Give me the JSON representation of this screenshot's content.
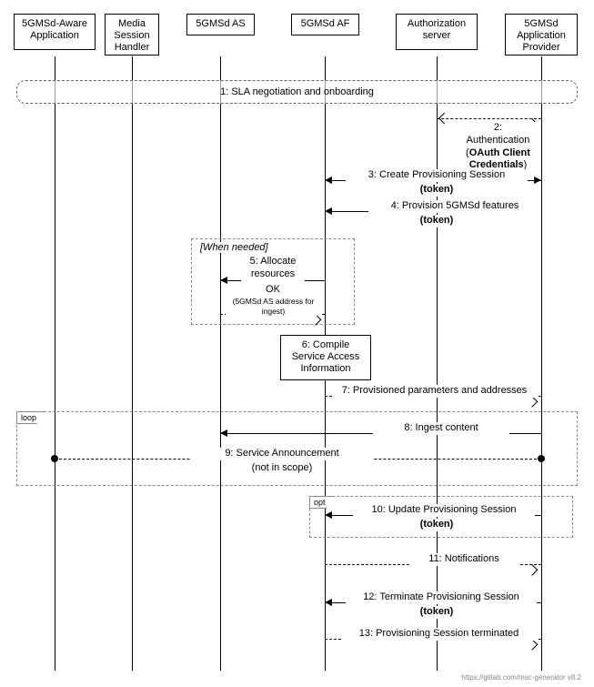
{
  "participants": [
    {
      "id": "app",
      "label": "5GMSd-Aware\nApplication"
    },
    {
      "id": "msh",
      "label": "Media\nSession\nHandler"
    },
    {
      "id": "as",
      "label": "5GMSd AS"
    },
    {
      "id": "af",
      "label": "5GMSd AF"
    },
    {
      "id": "auth",
      "label": "Authorization\nserver"
    },
    {
      "id": "prov",
      "label": "5GMSd\nApplication\nProvider"
    }
  ],
  "messages": {
    "m1": "1: SLA negotiation and onboarding",
    "m2a": "2:",
    "m2b": "Authentication",
    "m2c": "(OAuth Client",
    "m2d": "Credentials)",
    "m3a": "3: Create Provisioning Session",
    "m3b": "(token)",
    "m4a": "4: Provision 5GMSd features",
    "m4b": "(token)",
    "guard": "[When needed]",
    "m5a": "5: Allocate",
    "m5b": "resources",
    "m5c": "OK",
    "m5d": "(5GMSd AS address for",
    "m5e": "ingest)",
    "m6a": "6: Compile",
    "m6b": "Service Access",
    "m6c": "Information",
    "m7": "7: Provisioned parameters and addresses",
    "loop": "loop",
    "m8": "8: Ingest content",
    "m9a": "9: Service Announcement",
    "m9b": "(not in scope)",
    "opt": "opt",
    "m10a": "10: Update Provisioning Session",
    "m10b": "(token)",
    "m11": "11: Notifications",
    "m12a": "12: Terminate Provisioning Session",
    "m12b": "(token)",
    "m13": "13: Provisioning Session terminated"
  },
  "footer": "https://gitlab.com/msc-generator v8.2",
  "chart_data": {
    "type": "sequence-diagram",
    "participants": [
      "5GMSd-Aware Application",
      "Media Session Handler",
      "5GMSd AS",
      "5GMSd AF",
      "Authorization server",
      "5GMSd Application Provider"
    ],
    "fragments": [
      {
        "type": "loop",
        "covers": [
          "5GMSd-Aware Application",
          "5GMSd Application Provider"
        ],
        "contains": [
          "8",
          "9"
        ]
      },
      {
        "type": "opt",
        "covers": [
          "5GMSd AF",
          "5GMSd Application Provider"
        ],
        "contains": [
          "10"
        ]
      },
      {
        "type": "opt",
        "guard": "When needed",
        "covers": [
          "5GMSd AS",
          "5GMSd AF"
        ],
        "contains": [
          "5"
        ]
      }
    ],
    "interactions": [
      {
        "n": 1,
        "from": "*",
        "to": "*",
        "style": "box",
        "text": "SLA negotiation and onboarding"
      },
      {
        "n": 2,
        "from": "5GMSd Application Provider",
        "to": "Authorization server",
        "style": "bidir-dashed",
        "text": "Authentication (OAuth Client Credentials)"
      },
      {
        "n": 3,
        "from": "5GMSd Application Provider",
        "to": "5GMSd AF",
        "style": "solid",
        "text": "Create Provisioning Session (token)"
      },
      {
        "n": 4,
        "from": "5GMSd Application Provider",
        "to": "5GMSd AF",
        "style": "solid",
        "text": "Provision 5GMSd features (token)"
      },
      {
        "n": 5,
        "from": "5GMSd AF",
        "to": "5GMSd AS",
        "style": "solid",
        "text": "Allocate resources",
        "return": "OK (5GMSd AS address for ingest)"
      },
      {
        "n": 6,
        "at": "5GMSd AF",
        "style": "note",
        "text": "Compile Service Access Information"
      },
      {
        "n": 7,
        "from": "5GMSd AF",
        "to": "5GMSd Application Provider",
        "style": "dashed",
        "text": "Provisioned parameters and addresses"
      },
      {
        "n": 8,
        "from": "5GMSd Application Provider",
        "to": "5GMSd AS",
        "style": "solid",
        "text": "Ingest content"
      },
      {
        "n": 9,
        "from": "5GMSd Application Provider",
        "to": "5GMSd-Aware Application",
        "style": "bidir-dashed",
        "text": "Service Announcement (not in scope)"
      },
      {
        "n": 10,
        "from": "5GMSd Application Provider",
        "to": "5GMSd AF",
        "style": "solid",
        "text": "Update Provisioning Session (token)"
      },
      {
        "n": 11,
        "from": "5GMSd AF",
        "to": "5GMSd Application Provider",
        "style": "dashed",
        "text": "Notifications"
      },
      {
        "n": 12,
        "from": "5GMSd Application Provider",
        "to": "5GMSd AF",
        "style": "solid",
        "text": "Terminate Provisioning Session (token)"
      },
      {
        "n": 13,
        "from": "5GMSd AF",
        "to": "5GMSd Application Provider",
        "style": "dashed",
        "text": "Provisioning Session terminated"
      }
    ]
  }
}
